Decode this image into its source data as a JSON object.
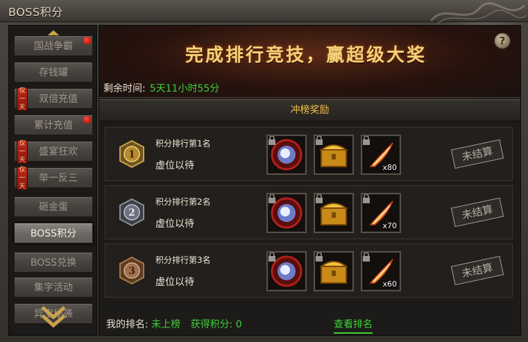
{
  "window": {
    "title": "BOSS积分"
  },
  "sidebar": {
    "items": [
      {
        "label": "国战争霸",
        "badge_red_dot": true,
        "tag": ""
      },
      {
        "label": "存钱罐",
        "badge_red_dot": false,
        "tag": ""
      },
      {
        "label": "双倍充值",
        "badge_red_dot": false,
        "tag": "仅一天"
      },
      {
        "label": "累计充值",
        "badge_red_dot": true,
        "tag": ""
      },
      {
        "label": "盛宴狂欢",
        "badge_red_dot": false,
        "tag": "仅一天"
      },
      {
        "label": "举一反三",
        "badge_red_dot": false,
        "tag": "仅一天"
      },
      {
        "label": "砸金蛋",
        "badge_red_dot": false,
        "tag": ""
      },
      {
        "label": "BOSS积分",
        "badge_red_dot": false,
        "tag": "",
        "active": true
      },
      {
        "label": "BOSS兑换",
        "badge_red_dot": false,
        "tag": ""
      },
      {
        "label": "集字活动",
        "badge_red_dot": false,
        "tag": ""
      },
      {
        "label": "异宝秘袭",
        "badge_red_dot": false,
        "tag": ""
      }
    ],
    "tag_chars": [
      "仅",
      "一",
      "天"
    ]
  },
  "banner": {
    "title": "完成排行竞技，赢超级大奖",
    "help": "?"
  },
  "remaining": {
    "label": "剩余时间:",
    "value": "5天11小时55分"
  },
  "section": {
    "title": "冲榜奖励"
  },
  "ranks": [
    {
      "title": "积分排行第1名",
      "status": "虚位以待",
      "medal": "1",
      "item3_qty": "x80",
      "stamp": "未结算"
    },
    {
      "title": "积分排行第2名",
      "status": "虚位以待",
      "medal": "2",
      "item3_qty": "x70",
      "stamp": "未结算"
    },
    {
      "title": "积分排行第3名",
      "status": "虚位以待",
      "medal": "3",
      "item3_qty": "x60",
      "stamp": "未结算"
    }
  ],
  "reward_icons": [
    "crystal-orb-icon",
    "treasure-chest-icon",
    "flame-feather-icon"
  ],
  "colors": {
    "accent_green": "#3ed13a",
    "gold": "#f2c14a",
    "red_badge": "#d0140a"
  },
  "footer": {
    "my_rank_label": "我的排名:",
    "my_rank_value": "未上榜",
    "points_label": "获得积分:",
    "points_value": "0",
    "view_rank": "查看排名"
  }
}
